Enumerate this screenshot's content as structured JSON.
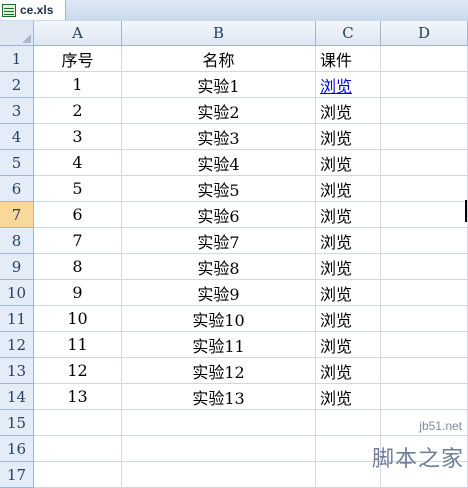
{
  "window": {
    "tab_title": "ce.xls",
    "file_icon": "excel-file-icon"
  },
  "sheet": {
    "columns": [
      "A",
      "B",
      "C",
      "D"
    ],
    "row_numbers": [
      "1",
      "2",
      "3",
      "4",
      "5",
      "6",
      "7",
      "8",
      "9",
      "10",
      "11",
      "12",
      "13",
      "14",
      "15",
      "16",
      "17"
    ],
    "active_row": "7",
    "rows": [
      {
        "A": "序号",
        "B": "名称",
        "C": "课件"
      },
      {
        "A": "1",
        "B": "实验1",
        "C": "浏览"
      },
      {
        "A": "2",
        "B": "实验2",
        "C": "浏览"
      },
      {
        "A": "3",
        "B": "实验3",
        "C": "浏览"
      },
      {
        "A": "4",
        "B": "实验4",
        "C": "浏览"
      },
      {
        "A": "5",
        "B": "实验5",
        "C": "浏览"
      },
      {
        "A": "6",
        "B": "实验6",
        "C": "浏览"
      },
      {
        "A": "7",
        "B": "实验7",
        "C": "浏览"
      },
      {
        "A": "8",
        "B": "实验8",
        "C": "浏览"
      },
      {
        "A": "9",
        "B": "实验9",
        "C": "浏览"
      },
      {
        "A": "10",
        "B": "实验10",
        "C": "浏览"
      },
      {
        "A": "11",
        "B": "实验11",
        "C": "浏览"
      },
      {
        "A": "12",
        "B": "实验12",
        "C": "浏览"
      },
      {
        "A": "13",
        "B": "实验13",
        "C": "浏览"
      },
      {
        "A": "",
        "B": "",
        "C": ""
      },
      {
        "A": "",
        "B": "",
        "C": ""
      },
      {
        "A": "",
        "B": "",
        "C": ""
      }
    ]
  },
  "watermark": {
    "url": "jb51.net",
    "name": "脚本之家"
  }
}
